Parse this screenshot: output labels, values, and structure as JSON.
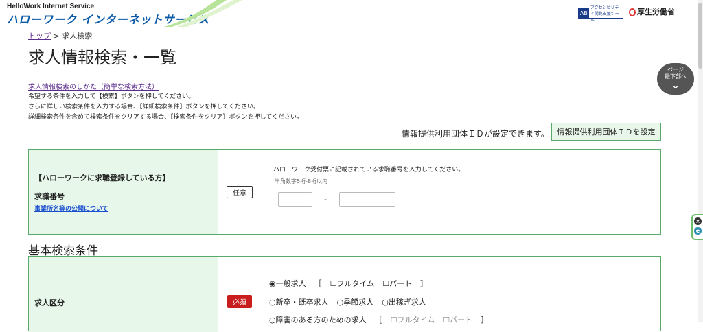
{
  "header": {
    "logo_en": "HelloWork Internet Service",
    "logo_jp": "ハローワーク インターネットサービス",
    "accessibility_mark": "AB",
    "accessibility_text": "アクセシビリティ閲覧支援ツール",
    "ministry": "厚生労働省"
  },
  "breadcrumb": {
    "top": "トップ",
    "current": "> 求人検索"
  },
  "page_title": "求人情報検索・一覧",
  "page_bottom_btn": {
    "line1": "ページ",
    "line2": "最下部へ",
    "chevron": "⌄"
  },
  "help": {
    "link": "求人情報検索のしかた（簡単な検索方法）",
    "lines": [
      "希望する条件を入力して【検索】ボタンを押してください。",
      "さらに詳しい検索条件を入力する場合、【詳細検索条件】ボタンを押してください。",
      "詳細検索条件を含めて検索条件をクリアする場合、【検索条件をクリア】ボタンを押してください。"
    ]
  },
  "org_id": {
    "label": "情報提供利用団体ＩＤが設定できます。",
    "button": "情報提供利用団体ＩＤを設定"
  },
  "job_seeker": {
    "registered": "【ハローワークに求職登録している方】",
    "number_label": "求職番号",
    "link": "事業所名等の公開について",
    "tag": "任意",
    "info": "ハローワーク受付票に記載されている求職番号を入力してください。",
    "hint": "半角数字5桁-8桁以内",
    "separator": "-"
  },
  "basic": {
    "section_title": "基本検索条件",
    "label": "求人区分",
    "tag": "必須",
    "row1": {
      "radio": "◉一般求人",
      "open": "［",
      "ft": "☐フルタイム",
      "pt": "☐パート",
      "close": "］"
    },
    "row2": [
      "○新卒・既卒求人",
      "○季節求人",
      "○出稼ぎ求人"
    ],
    "row3": {
      "radio": "○障害のある方のための求人",
      "open": "［",
      "ft": "☐フルタイム",
      "pt": "☐パート",
      "close": "］"
    }
  },
  "side": {
    "close": "×",
    "open": "e"
  },
  "colors": {
    "accent_green": "#59a96a",
    "label_bg": "#e7f8ea",
    "required_red": "#c81e1e",
    "logo_blue": "#0a5aa8"
  }
}
